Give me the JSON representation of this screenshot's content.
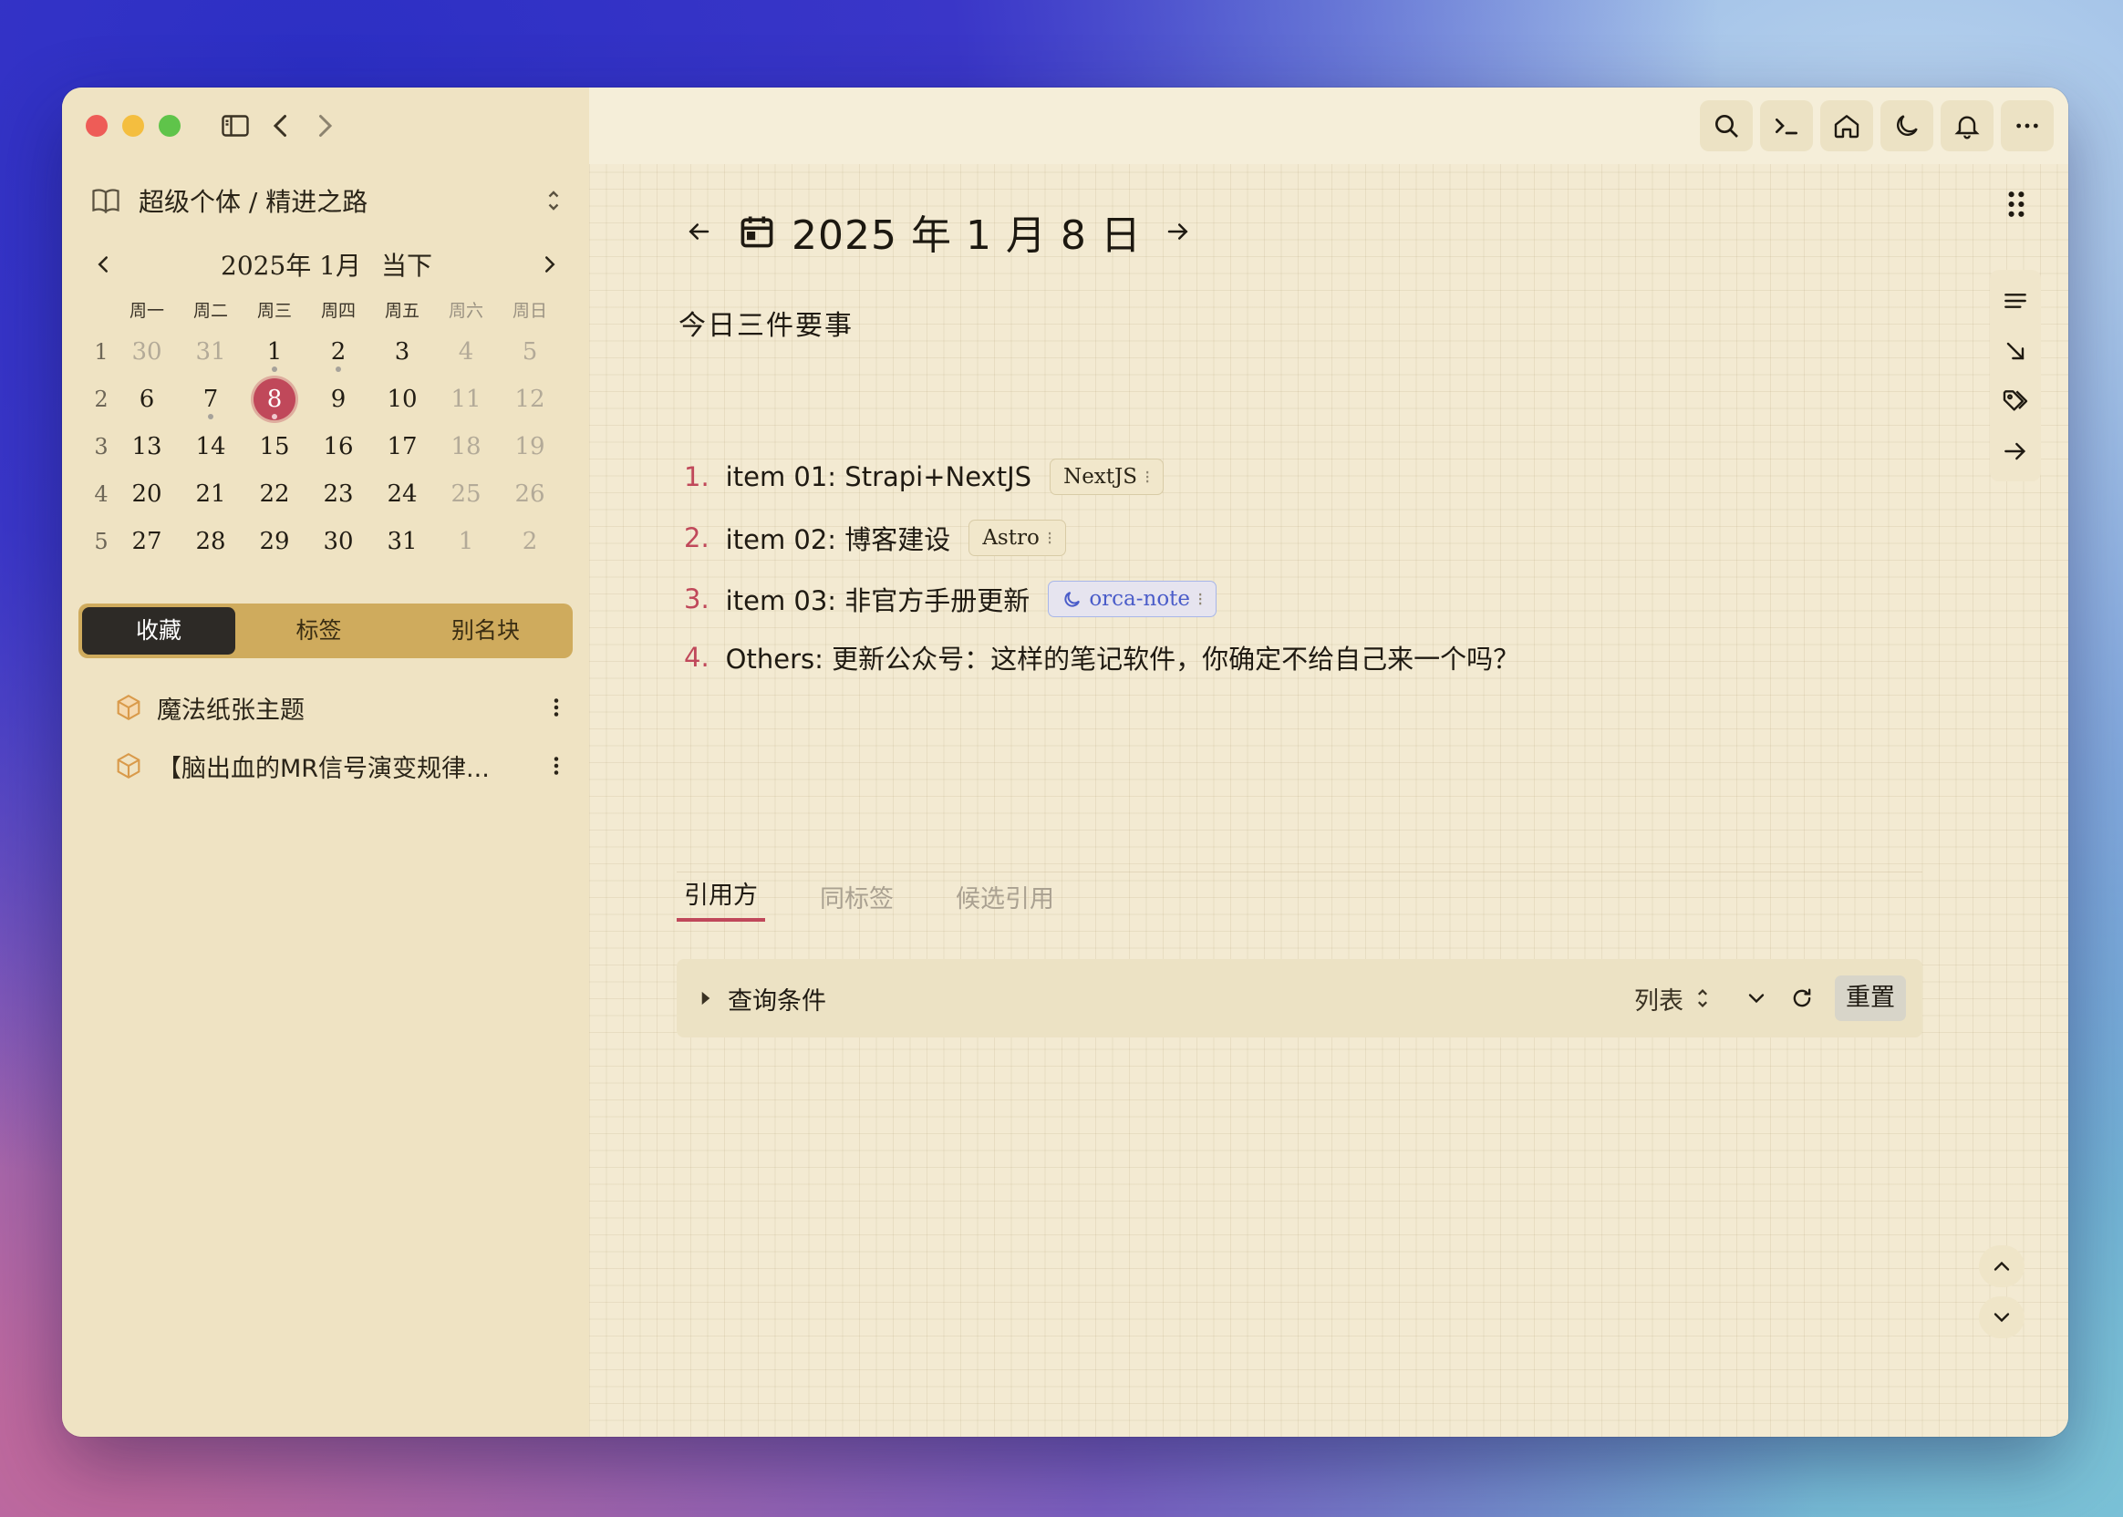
{
  "sidebar": {
    "workspace": "超级个体 / 精进之路",
    "calendar": {
      "month_label": "2025年 1月",
      "today_label": "当下",
      "weekdays": [
        "周一",
        "周二",
        "周三",
        "周四",
        "周五",
        "周六",
        "周日"
      ],
      "weeks": [
        {
          "wk": "1",
          "days": [
            "30",
            "31",
            "1",
            "2",
            "3",
            "4",
            "5"
          ]
        },
        {
          "wk": "2",
          "days": [
            "6",
            "7",
            "8",
            "9",
            "10",
            "11",
            "12"
          ]
        },
        {
          "wk": "3",
          "days": [
            "13",
            "14",
            "15",
            "16",
            "17",
            "18",
            "19"
          ]
        },
        {
          "wk": "4",
          "days": [
            "20",
            "21",
            "22",
            "23",
            "24",
            "25",
            "26"
          ]
        },
        {
          "wk": "5",
          "days": [
            "27",
            "28",
            "29",
            "30",
            "31",
            "1",
            "2"
          ]
        }
      ]
    },
    "tabs": [
      "收藏",
      "标签",
      "别名块"
    ],
    "favorites": [
      "魔法纸张主题",
      "【脑出血的MR信号演变规律..."
    ]
  },
  "main": {
    "date_title": "2025 年 1 月 8 日",
    "heading": "今日三件要事",
    "todos": [
      {
        "num": "1.",
        "text": "item 01: Strapi+NextJS",
        "tag": "NextJS"
      },
      {
        "num": "2.",
        "text": "item 02: 博客建设",
        "tag": "Astro"
      },
      {
        "num": "3.",
        "text": "item 03: 非官方手册更新",
        "tag": "orca-note"
      },
      {
        "num": "4.",
        "text": "Others: 更新公众号：这样的笔记软件，你确定不给自己来一个吗？",
        "tag": ""
      }
    ],
    "ref_tabs": [
      "引用方",
      "同标签",
      "候选引用"
    ],
    "query_label": "查询条件",
    "view_mode": "列表",
    "reset_label": "重置"
  },
  "colors": {
    "accent": "#c0485a",
    "segment": "#cfab5d",
    "paper": "#f3ead2"
  }
}
